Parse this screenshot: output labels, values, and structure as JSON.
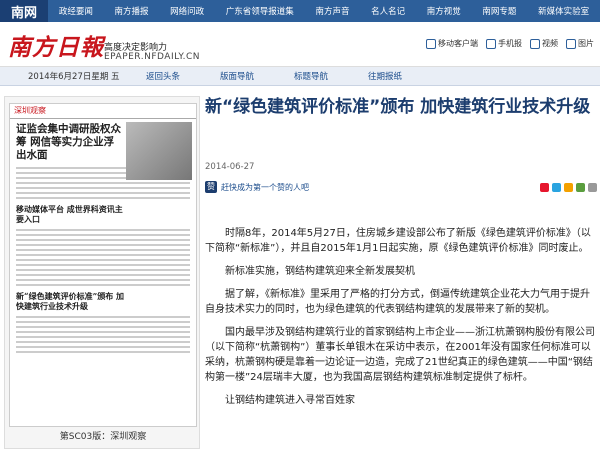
{
  "topnav": {
    "logo": "南网",
    "items": [
      "政经要闻",
      "南方播报",
      "网络问政",
      "广东省领导报道集",
      "南方声音",
      "名人名记",
      "南方视觉",
      "南网专题",
      "新媒体实验室"
    ]
  },
  "brand": {
    "name": "南方日報",
    "slogan": "高度决定影响力",
    "url": "EPAPER.NFDAILY.CN",
    "tools": [
      "移动客户端",
      "手机报",
      "视频",
      "图片"
    ]
  },
  "bar": {
    "date": "2014年6月27日星期 五",
    "links": [
      "返回头条",
      "版面导航",
      "标题导航",
      "往期报纸"
    ]
  },
  "paper": {
    "header": "深圳观察",
    "headline1": "证监会集中调研股权众筹 网信等实力企业浮出水面",
    "headline2": "移动媒体平台 成世界科资讯主要入口",
    "headline3": "新“绿色建筑评价标准”颁布 加快建筑行业技术升级",
    "page_label": "第SC03版：深圳观察"
  },
  "article": {
    "title": "新“绿色建筑评价标准”颁布 加快建筑行业技术升级",
    "date": "2014-06-27",
    "like_text": "赶快成为第一个赞的人吧",
    "p1": "时隔8年，2014年5月27日，住房城乡建设部公布了新版《绿色建筑评价标准》（以下简称“新标准”），并且自2015年1月1日起实施，原《绿色建筑评价标准》同时废止。",
    "p2": "新标准实施，钢结构建筑迎来全新发展契机",
    "p3": "据了解，《新标准》里采用了严格的打分方式，倒逼传统建筑企业花大力气用于提升自身技术实力的同时，也为绿色建筑的代表钢结构建筑的发展带来了新的契机。",
    "p4": "国内最早涉及钢结构建筑行业的首家钢结构上市企业——浙江杭萧钢构股份有限公司（以下简称“杭萧钢构”）董事长单银木在采访中表示，在2001年没有国家任何标准可以采纳，杭萧钢构硬是靠着一边论证一边造，完成了21世纪真正的绿色建筑——中国“钢结构第一楼”24层瑞丰大厦，也为我国高层钢结构建筑标准制定提供了标杆。",
    "p5": "让钢结构建筑进入寻常百姓家"
  }
}
